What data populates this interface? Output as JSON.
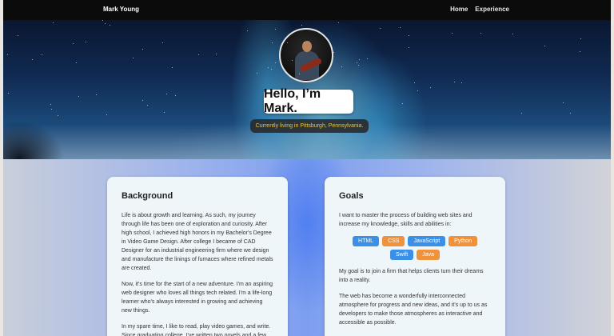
{
  "navbar": {
    "brand": "Mark Young",
    "links": [
      "Home",
      "Experience"
    ]
  },
  "hero": {
    "title": "Hello, I’m Mark.",
    "subtitle": "Currently living in Pittsburgh, Pennsylvania."
  },
  "background": {
    "heading": "Background",
    "paragraphs": [
      "Life is about growth and learning. As such, my journey through life has been one of exploration and curiosity. After high school, I achieved high honors in my Bachelor's Degree in Video Game Design. After college I became of CAD Designer for an industrial engineering firm where we design and manufacture the linings of furnaces where refined metals are created.",
      "Now, it's time for the start of a new adventure. I'm an aspiring web designer who loves all things tech related. I'm a life-long learner who's always interested in growing and achieving new things.",
      "In my spare time, I like to read, play video games, and write. Since graduating college, I've written two novels and a few"
    ]
  },
  "goals": {
    "heading": "Goals",
    "intro": "I want to master the process of building web sites and increase my knowledge, skills and abilities in:",
    "skills": [
      {
        "label": "HTML",
        "color": "#3b8fe6"
      },
      {
        "label": "CSS",
        "color": "#f0923a"
      },
      {
        "label": "JavaScript",
        "color": "#3b8fe6"
      },
      {
        "label": "Python",
        "color": "#f0923a"
      },
      {
        "label": "Swift",
        "color": "#3b8fe6"
      },
      {
        "label": "Java",
        "color": "#f0923a"
      }
    ],
    "paragraphs": [
      "My goal is to join a firm that helps clients turn their dreams into a reality.",
      "The web has become a wonderfully interconnected atmosphere for progress and new ideas, and it's up to us as developers to make those atmospheres as interactive and accessible as possible."
    ]
  }
}
